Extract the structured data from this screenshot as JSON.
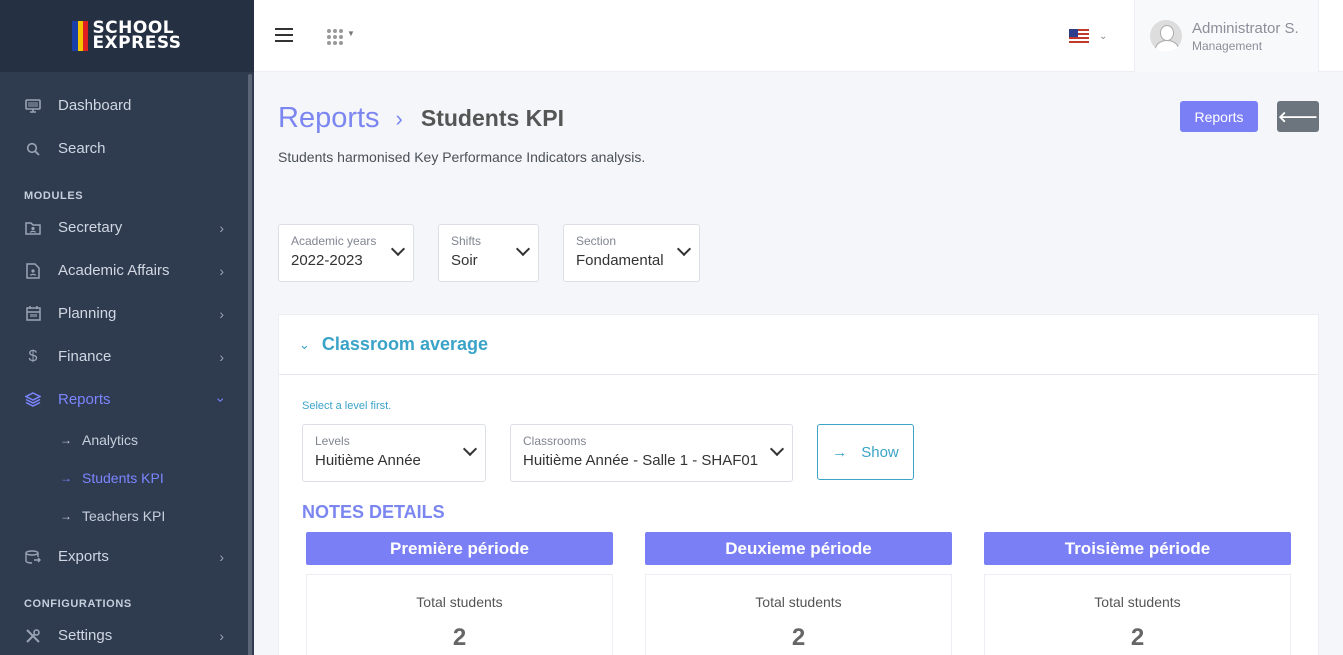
{
  "brand": {
    "line1": "SCHOOL",
    "line2": "EXPRESS"
  },
  "sidebar": {
    "top_items": [
      {
        "label": "Dashboard",
        "icon": "monitor-icon"
      },
      {
        "label": "Search",
        "icon": "search-icon"
      }
    ],
    "modules_title": "MODULES",
    "modules": [
      {
        "label": "Secretary",
        "icon": "folder-user-icon"
      },
      {
        "label": "Academic Affairs",
        "icon": "document-user-icon"
      },
      {
        "label": "Planning",
        "icon": "calendar-icon"
      },
      {
        "label": "Finance",
        "icon": "dollar-icon"
      },
      {
        "label": "Reports",
        "icon": "layers-icon",
        "active": true
      }
    ],
    "report_sub": [
      {
        "label": "Analytics"
      },
      {
        "label": "Students KPI",
        "active": true
      },
      {
        "label": "Teachers KPI"
      }
    ],
    "exports_label": "Exports",
    "config_title": "CONFIGURATIONS",
    "settings_label": "Settings"
  },
  "topbar": {
    "language": "en-US",
    "user_name": "Administrator S.",
    "user_role": "Management"
  },
  "page": {
    "breadcrumb_link": "Reports",
    "title": "Students KPI",
    "description": "Students harmonised Key Performance Indicators analysis.",
    "reports_button": "Reports",
    "back_button": "🡐"
  },
  "filters": {
    "academic_years": {
      "label": "Academic years",
      "value": "2022-2023"
    },
    "shifts": {
      "label": "Shifts",
      "value": "Soir"
    },
    "section": {
      "label": "Section",
      "value": "Fondamental"
    }
  },
  "classroom_card": {
    "title": "Classroom average",
    "hint": "Select a level first.",
    "levels": {
      "label": "Levels",
      "value": "Huitième Année"
    },
    "classrooms": {
      "label": "Classrooms",
      "value": "Huitième Année - Salle 1 - SHAF01"
    },
    "show_button": "Show",
    "notes_title": "NOTES DETAILS",
    "periods": [
      {
        "title": "Première période",
        "stat_label": "Total students",
        "stat_value": "2"
      },
      {
        "title": "Deuxieme période",
        "stat_label": "Total students",
        "stat_value": "2"
      },
      {
        "title": "Troisième période",
        "stat_label": "Total students",
        "stat_value": "2"
      }
    ]
  },
  "colors": {
    "accent": "#7b7ff5",
    "teal": "#3aa3c8",
    "sidebar_bg": "#2f3b4f"
  }
}
